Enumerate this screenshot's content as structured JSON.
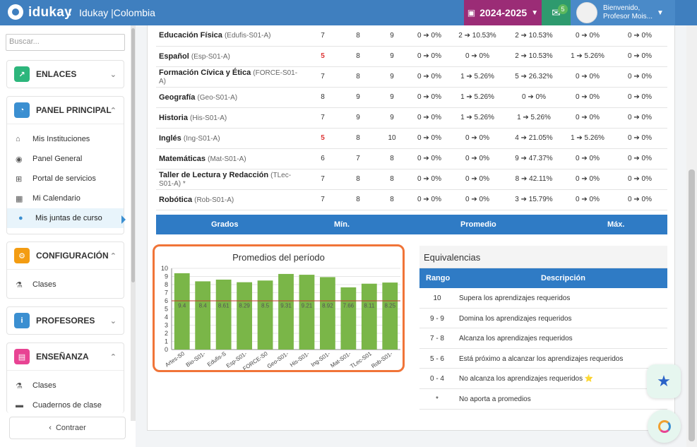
{
  "topbar": {
    "brand": "idukay",
    "separator": ":",
    "institution": "Idukay |Colombia",
    "year": "2024-2025",
    "mail_count": "5",
    "greeting": "Bienvenido,",
    "user_name": "Profesor Mois..."
  },
  "sidebar": {
    "search_placeholder": "Buscar...",
    "sections": [
      {
        "label": "ENLACES",
        "color": "#2db67c",
        "icon": "link-icon",
        "expanded": false,
        "items": []
      },
      {
        "label": "PANEL PRINCIPAL",
        "color": "#3b8fd1",
        "icon": "dashboard-icon",
        "expanded": true,
        "items": [
          {
            "label": "Mis Instituciones",
            "icon": "institution-icon"
          },
          {
            "label": "Panel General",
            "icon": "palette-icon"
          },
          {
            "label": "Portal de servicios",
            "icon": "cart-icon"
          },
          {
            "label": "Mi Calendario",
            "icon": "calendar-icon"
          },
          {
            "label": "Mis juntas de curso",
            "icon": "users-icon",
            "active": true
          }
        ]
      },
      {
        "label": "CONFIGURACIÓN",
        "color": "#f39c12",
        "icon": "cogs-icon",
        "expanded": true,
        "items": [
          {
            "label": "Clases",
            "icon": "flask-icon"
          }
        ]
      },
      {
        "label": "PROFESORES",
        "color": "#3b8fd1",
        "icon": "info-icon",
        "expanded": false,
        "items": []
      },
      {
        "label": "ENSEÑANZA",
        "color": "#e84393",
        "icon": "book-icon",
        "expanded": true,
        "items": [
          {
            "label": "Clases",
            "icon": "flask-icon"
          },
          {
            "label": "Cuadernos de clase",
            "icon": "notebook-icon"
          }
        ]
      }
    ],
    "collapse_label": "Contraer"
  },
  "grades": {
    "rows": [
      {
        "name": "Educación Física",
        "code": "(Edufis-S01-A)",
        "min": "7",
        "prom": "8",
        "max": "9",
        "c1": "0 ➔ 0%",
        "c2": "2 ➔ 10.53%",
        "c3": "2 ➔ 10.53%",
        "c4": "0 ➔ 0%",
        "c5": "0 ➔ 0%",
        "min_red": false
      },
      {
        "name": "Español",
        "code": "(Esp-S01-A)",
        "min": "5",
        "prom": "8",
        "max": "9",
        "c1": "0 ➔ 0%",
        "c2": "0 ➔ 0%",
        "c3": "2 ➔ 10.53%",
        "c4": "1 ➔ 5.26%",
        "c5": "0 ➔ 0%",
        "min_red": true
      },
      {
        "name": "Formación Cívica y Ética",
        "code": "(FORCE-S01-A)",
        "min": "7",
        "prom": "8",
        "max": "9",
        "c1": "0 ➔ 0%",
        "c2": "1 ➔ 5.26%",
        "c3": "5 ➔ 26.32%",
        "c4": "0 ➔ 0%",
        "c5": "0 ➔ 0%",
        "min_red": false
      },
      {
        "name": "Geografía",
        "code": "(Geo-S01-A)",
        "min": "8",
        "prom": "9",
        "max": "9",
        "c1": "0 ➔ 0%",
        "c2": "1 ➔ 5.26%",
        "c3": "0 ➔ 0%",
        "c4": "0 ➔ 0%",
        "c5": "0 ➔ 0%",
        "min_red": false
      },
      {
        "name": "Historia",
        "code": "(His-S01-A)",
        "min": "7",
        "prom": "9",
        "max": "9",
        "c1": "0 ➔ 0%",
        "c2": "1 ➔ 5.26%",
        "c3": "1 ➔ 5.26%",
        "c4": "0 ➔ 0%",
        "c5": "0 ➔ 0%",
        "min_red": false
      },
      {
        "name": "Inglés",
        "code": "(Ing-S01-A)",
        "min": "5",
        "prom": "8",
        "max": "10",
        "c1": "0 ➔ 0%",
        "c2": "0 ➔ 0%",
        "c3": "4 ➔ 21.05%",
        "c4": "1 ➔ 5.26%",
        "c5": "0 ➔ 0%",
        "min_red": true
      },
      {
        "name": "Matemáticas",
        "code": "(Mat-S01-A)",
        "min": "6",
        "prom": "7",
        "max": "8",
        "c1": "0 ➔ 0%",
        "c2": "0 ➔ 0%",
        "c3": "9 ➔ 47.37%",
        "c4": "0 ➔ 0%",
        "c5": "0 ➔ 0%",
        "min_red": false
      },
      {
        "name": "Taller de Lectura y Redacción",
        "code": "(TLec-S01-A)  *",
        "min": "7",
        "prom": "8",
        "max": "8",
        "c1": "0 ➔ 0%",
        "c2": "0 ➔ 0%",
        "c3": "8 ➔ 42.11%",
        "c4": "0 ➔ 0%",
        "c5": "0 ➔ 0%",
        "min_red": false
      },
      {
        "name": "Robótica",
        "code": "(Rob-S01-A)",
        "min": "7",
        "prom": "8",
        "max": "8",
        "c1": "0 ➔ 0%",
        "c2": "0 ➔ 0%",
        "c3": "3 ➔ 15.79%",
        "c4": "0 ➔ 0%",
        "c5": "0 ➔ 0%",
        "min_red": false
      }
    ],
    "footer": {
      "grados": "Grados",
      "min": "Mín.",
      "promedio": "Promedio",
      "max": "Máx."
    }
  },
  "chart_data": {
    "type": "bar",
    "title": "Promedios del período",
    "categories": [
      "Artes-S0",
      "Bio-S01-",
      "Edufis-S",
      "Esp-S01-",
      "FORCE-S0",
      "Geo-S01-",
      "His-S01-",
      "Ing-S01-",
      "Mat-S01-",
      "TLec-S01",
      "Rob-S01-"
    ],
    "values": [
      9.4,
      8.4,
      8.61,
      8.29,
      8.5,
      9.31,
      9.21,
      8.92,
      7.66,
      8.11,
      8.25
    ],
    "value_labels": [
      "9.4",
      "8.4",
      "8.61",
      "8.29",
      "8.5",
      "9.31",
      "9.21",
      "8.92",
      "7.66",
      "8.11",
      "8.25"
    ],
    "ylim": [
      0,
      10
    ],
    "yticks": [
      "0",
      "1",
      "2",
      "3",
      "4",
      "5",
      "6",
      "7",
      "8",
      "9",
      "10"
    ],
    "reference_line": 6,
    "bar_color": "#7ab648",
    "reference_color": "#c0392b",
    "grid": true
  },
  "equivalencias": {
    "title": "Equivalencias",
    "header_rango": "Rango",
    "header_desc": "Descripción",
    "rows": [
      {
        "rango": "10",
        "desc": "Supera los aprendizajes requeridos"
      },
      {
        "rango": "9 - 9",
        "desc": "Domina los aprendizajes requeridos"
      },
      {
        "rango": "7 - 8",
        "desc": "Alcanza los aprendizajes requeridos"
      },
      {
        "rango": "5 - 6",
        "desc": "Está próximo a alcanzar los aprendizajes requeridos"
      },
      {
        "rango": "0 - 4",
        "desc": "No alcanza los aprendizajes requeridos ⭐"
      },
      {
        "rango": "*",
        "desc": "No aporta a promedios"
      }
    ]
  }
}
